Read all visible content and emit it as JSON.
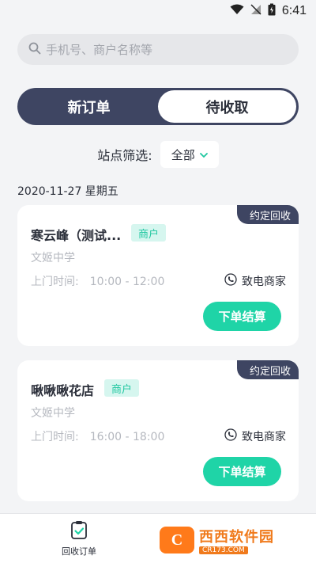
{
  "status": {
    "time": "6:41"
  },
  "search": {
    "placeholder": "手机号、商户名称等"
  },
  "tabs": [
    {
      "label": "新订单",
      "active": false
    },
    {
      "label": "待收取",
      "active": true
    }
  ],
  "filter": {
    "label": "站点筛选:",
    "value": "全部"
  },
  "date": "2020-11-27 星期五",
  "orders": [
    {
      "tag": "约定回收",
      "name": "寒云峰（测试...",
      "type": "商户",
      "school": "文姬中学",
      "visit_label": "上门时间:",
      "visit_time": "10:00 - 12:00",
      "call_label": "致电商家",
      "action_label": "下单结算"
    },
    {
      "tag": "约定回收",
      "name": "啾啾啾花店",
      "type": "商户",
      "school": "文姬中学",
      "visit_label": "上门时间:",
      "visit_time": "16:00 - 18:00",
      "call_label": "致电商家",
      "action_label": "下单结算"
    }
  ],
  "nav": {
    "item_label": "回收订单"
  },
  "watermark": {
    "logo": "C",
    "title": "西西软件园",
    "url": "CR173.COM"
  },
  "colors": {
    "primary": "#3e4562",
    "accent": "#1fd4a7",
    "badge_bg": "#d6f6ef",
    "badge_text": "#1fc7a0"
  }
}
